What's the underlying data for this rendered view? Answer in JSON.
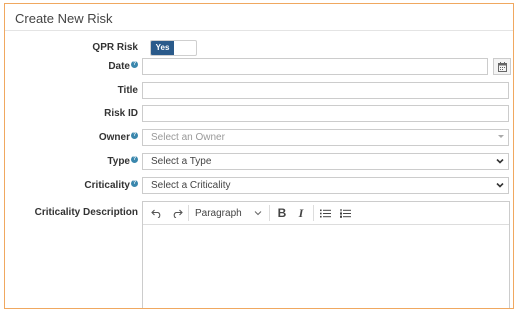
{
  "panel": {
    "title": "Create New Risk"
  },
  "fields": {
    "qpr_risk": {
      "label": "QPR Risk",
      "toggle_on_label": "Yes"
    },
    "date": {
      "label": "Date",
      "value": ""
    },
    "title": {
      "label": "Title",
      "value": ""
    },
    "risk_id": {
      "label": "Risk ID",
      "value": ""
    },
    "owner": {
      "label": "Owner",
      "placeholder": "Select an Owner"
    },
    "type": {
      "label": "Type",
      "selected": "Select a Type"
    },
    "criticality": {
      "label": "Criticality",
      "selected": "Select a Criticality"
    },
    "criticality_description": {
      "label": "Criticality Description"
    }
  },
  "editor": {
    "block_format": "Paragraph",
    "content": ""
  },
  "colors": {
    "panel_border": "#f0a860",
    "toggle_on": "#2a5a8a",
    "help_icon": "#3a87ad"
  },
  "icons": [
    "help-icon",
    "calendar-icon",
    "chevron-down-icon",
    "undo-icon",
    "redo-icon",
    "bullet-list-icon",
    "numbered-list-icon"
  ]
}
